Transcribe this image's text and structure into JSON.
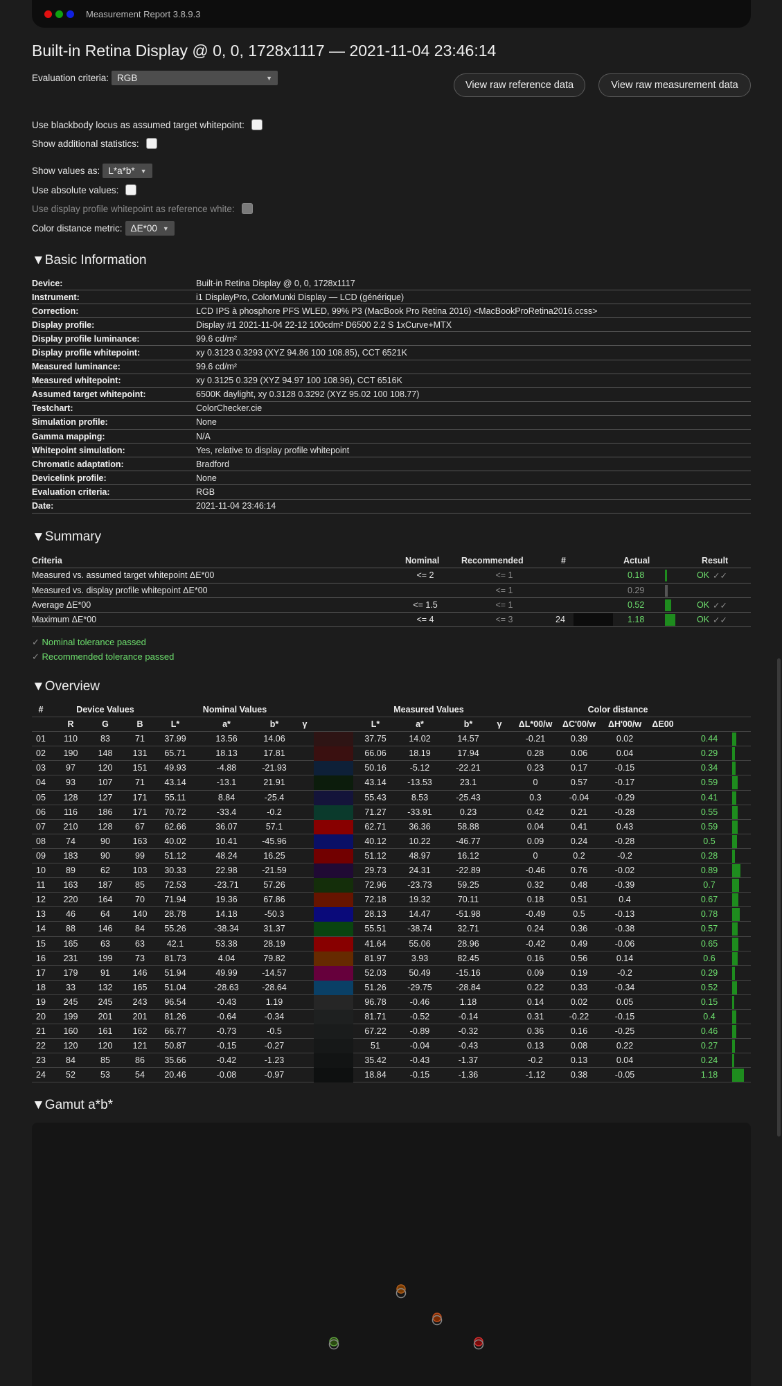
{
  "window": {
    "title": "Measurement Report 3.8.9.3"
  },
  "page_title": "Built-in Retina Display @ 0, 0, 1728x1117 — 2021-11-04 23:46:14",
  "controls": {
    "evaluation_label": "Evaluation criteria:",
    "evaluation_value": "RGB",
    "view_ref_button": "View raw reference data",
    "view_meas_button": "View raw measurement data",
    "blackbody_label": "Use blackbody locus as assumed target whitepoint:",
    "additional_stats_label": "Show additional statistics:",
    "show_values_label": "Show values as:",
    "show_values_value": "L*a*b*",
    "absolute_label": "Use absolute values:",
    "profile_white_label": "Use display profile whitepoint as reference white:",
    "distance_label": "Color distance metric:",
    "distance_value": "ΔE*00",
    "dropdown_arrow": "▼"
  },
  "sections": {
    "basic": "▼Basic Information",
    "summary": "▼Summary",
    "overview": "▼Overview",
    "gamut": "▼Gamut a*b*"
  },
  "basic_info": [
    {
      "k": "Device:",
      "v": "Built-in Retina Display @ 0, 0, 1728x1117"
    },
    {
      "k": "Instrument:",
      "v": "i1 DisplayPro, ColorMunki Display — LCD (générique)"
    },
    {
      "k": "Correction:",
      "v": "LCD IPS à phosphore PFS WLED, 99% P3 (MacBook Pro Retina 2016) <MacBookProRetina2016.ccss>"
    },
    {
      "k": "Display profile:",
      "v": "Display #1 2021-11-04 22-12 100cdm² D6500 2.2 S 1xCurve+MTX"
    },
    {
      "k": "Display profile luminance:",
      "v": "99.6 cd/m²"
    },
    {
      "k": "Display profile whitepoint:",
      "v": "xy 0.3123 0.3293 (XYZ 94.86 100 108.85), CCT 6521K"
    },
    {
      "k": "Measured luminance:",
      "v": "99.6 cd/m²"
    },
    {
      "k": "Measured whitepoint:",
      "v": "xy 0.3125 0.329 (XYZ 94.97 100 108.96), CCT 6516K"
    },
    {
      "k": "Assumed target whitepoint:",
      "v": "6500K daylight, xy 0.3128 0.3292 (XYZ 95.02 100 108.77)"
    },
    {
      "k": "Testchart:",
      "v": "ColorChecker.cie"
    },
    {
      "k": "Simulation profile:",
      "v": "None"
    },
    {
      "k": "Gamma mapping:",
      "v": "N/A"
    },
    {
      "k": "Whitepoint simulation:",
      "v": "Yes, relative to display profile whitepoint"
    },
    {
      "k": "Chromatic adaptation:",
      "v": "Bradford"
    },
    {
      "k": "Devicelink profile:",
      "v": "None"
    },
    {
      "k": "Evaluation criteria:",
      "v": "RGB"
    },
    {
      "k": "Date:",
      "v": "2021-11-04 23:46:14"
    }
  ],
  "summary": {
    "headers": {
      "criteria": "Criteria",
      "nominal": "Nominal",
      "recommended": "Recommended",
      "count": "#",
      "actual": "Actual",
      "result": "Result"
    },
    "rows": [
      {
        "criteria": "Measured vs. assumed target whitepoint ΔE*00",
        "nominal": "<= 2",
        "recommended": "<= 1",
        "count": "",
        "actual": "0.18",
        "fill": 0.09,
        "result": "OK",
        "ticks": "✓✓",
        "pass": true
      },
      {
        "criteria": "Measured vs. display profile whitepoint ΔE*00",
        "nominal": "",
        "recommended": "<= 1",
        "count": "",
        "actual": "0.29",
        "fill": 0.15,
        "result": "",
        "ticks": "",
        "pass": false
      },
      {
        "criteria": "Average ΔE*00",
        "nominal": "<= 1.5",
        "recommended": "<= 1",
        "count": "",
        "actual": "0.52",
        "fill": 0.35,
        "result": "OK",
        "ticks": "✓✓",
        "pass": true
      },
      {
        "criteria": "Maximum ΔE*00",
        "nominal": "<= 4",
        "recommended": "<= 3",
        "count": "24",
        "actual": "1.18",
        "fill": 0.6,
        "result": "OK",
        "ticks": "✓✓",
        "pass": true
      }
    ],
    "legend": [
      {
        "mark": "✓",
        "text": "Nominal tolerance passed"
      },
      {
        "mark": "✓",
        "text": "Recommended tolerance passed"
      }
    ]
  },
  "overview": {
    "group_headers": {
      "num": "#",
      "device": "Device Values",
      "nominal": "Nominal Values",
      "measured": "Measured Values",
      "distance": "Color distance"
    },
    "col_headers": {
      "r": "R",
      "g": "G",
      "b": "B",
      "L": "L*",
      "a": "a*",
      "bb": "b*",
      "gamma": "γ",
      "mL": "L*",
      "ma": "a*",
      "mb": "b*",
      "mgamma": "γ",
      "dL": "ΔL*00/w",
      "dC": "ΔC'00/w",
      "dH": "ΔH'00/w",
      "dE": "ΔE00"
    },
    "rows": [
      [
        "01",
        "110",
        "83",
        "71",
        "37.99",
        "13.56",
        "14.06",
        "#2e1414",
        "37.75",
        "14.02",
        "14.57",
        "-0.21",
        "0.39",
        "0.02",
        "0.44"
      ],
      [
        "02",
        "190",
        "148",
        "131",
        "65.71",
        "18.13",
        "17.81",
        "#3a1010",
        "66.06",
        "18.19",
        "17.94",
        "0.28",
        "0.06",
        "0.04",
        "0.29"
      ],
      [
        "03",
        "97",
        "120",
        "151",
        "49.93",
        "-4.88",
        "-21.93",
        "#0e2038",
        "50.16",
        "-5.12",
        "-22.21",
        "0.23",
        "0.17",
        "-0.15",
        "0.34"
      ],
      [
        "04",
        "93",
        "107",
        "71",
        "43.14",
        "-13.1",
        "21.91",
        "#0c1c0c",
        "43.14",
        "-13.53",
        "23.1",
        "0",
        "0.57",
        "-0.17",
        "0.59"
      ],
      [
        "05",
        "128",
        "127",
        "171",
        "55.11",
        "8.84",
        "-25.4",
        "#14143a",
        "55.43",
        "8.53",
        "-25.43",
        "0.3",
        "-0.04",
        "-0.29",
        "0.41"
      ],
      [
        "06",
        "116",
        "186",
        "171",
        "70.72",
        "-33.4",
        "-0.2",
        "#0a3a2c",
        "71.27",
        "-33.91",
        "0.23",
        "0.42",
        "0.21",
        "-0.28",
        "0.55"
      ],
      [
        "07",
        "210",
        "128",
        "67",
        "62.66",
        "36.07",
        "57.1",
        "#880000",
        "62.71",
        "36.36",
        "58.88",
        "0.04",
        "0.41",
        "0.43",
        "0.59"
      ],
      [
        "08",
        "74",
        "90",
        "163",
        "40.02",
        "10.41",
        "-45.96",
        "#0a1066",
        "40.12",
        "10.22",
        "-46.77",
        "0.09",
        "0.24",
        "-0.28",
        "0.5"
      ],
      [
        "09",
        "183",
        "90",
        "99",
        "51.12",
        "48.24",
        "16.25",
        "#720000",
        "51.12",
        "48.97",
        "16.12",
        "0",
        "0.2",
        "-0.2",
        "0.28"
      ],
      [
        "10",
        "89",
        "62",
        "103",
        "30.33",
        "22.98",
        "-21.59",
        "#200a34",
        "29.73",
        "24.31",
        "-22.89",
        "-0.46",
        "0.76",
        "-0.02",
        "0.89"
      ],
      [
        "11",
        "163",
        "187",
        "85",
        "72.53",
        "-23.71",
        "57.26",
        "#142e0a",
        "72.96",
        "-23.73",
        "59.25",
        "0.32",
        "0.48",
        "-0.39",
        "0.7"
      ],
      [
        "12",
        "220",
        "164",
        "70",
        "71.94",
        "19.36",
        "67.86",
        "#661400",
        "72.18",
        "19.32",
        "70.11",
        "0.18",
        "0.51",
        "0.4",
        "0.67"
      ],
      [
        "13",
        "46",
        "64",
        "140",
        "28.78",
        "14.18",
        "-50.3",
        "#0a0a7a",
        "28.13",
        "14.47",
        "-51.98",
        "-0.49",
        "0.5",
        "-0.13",
        "0.78"
      ],
      [
        "14",
        "88",
        "146",
        "84",
        "55.26",
        "-38.34",
        "31.37",
        "#0a4410",
        "55.51",
        "-38.74",
        "32.71",
        "0.24",
        "0.36",
        "-0.38",
        "0.57"
      ],
      [
        "15",
        "165",
        "63",
        "63",
        "42.1",
        "53.38",
        "28.19",
        "#880000",
        "41.64",
        "55.06",
        "28.96",
        "-0.42",
        "0.49",
        "-0.06",
        "0.65"
      ],
      [
        "16",
        "231",
        "199",
        "73",
        "81.73",
        "4.04",
        "79.82",
        "#662a00",
        "81.97",
        "3.93",
        "82.45",
        "0.16",
        "0.56",
        "0.14",
        "0.6"
      ],
      [
        "17",
        "179",
        "91",
        "146",
        "51.94",
        "49.99",
        "-14.57",
        "#66003c",
        "52.03",
        "50.49",
        "-15.16",
        "0.09",
        "0.19",
        "-0.2",
        "0.29"
      ],
      [
        "18",
        "33",
        "132",
        "165",
        "51.04",
        "-28.63",
        "-28.64",
        "#0a4066",
        "51.26",
        "-29.75",
        "-28.84",
        "0.22",
        "0.33",
        "-0.34",
        "0.52"
      ],
      [
        "19",
        "245",
        "245",
        "243",
        "96.54",
        "-0.43",
        "1.19",
        "#262626",
        "96.78",
        "-0.46",
        "1.18",
        "0.14",
        "0.02",
        "0.05",
        "0.15"
      ],
      [
        "20",
        "199",
        "201",
        "201",
        "81.26",
        "-0.64",
        "-0.34",
        "#1e2020",
        "81.71",
        "-0.52",
        "-0.14",
        "0.31",
        "-0.22",
        "-0.15",
        "0.4"
      ],
      [
        "21",
        "160",
        "161",
        "162",
        "66.77",
        "-0.73",
        "-0.5",
        "#1a1c1c",
        "67.22",
        "-0.89",
        "-0.32",
        "0.36",
        "0.16",
        "-0.25",
        "0.46"
      ],
      [
        "22",
        "120",
        "120",
        "121",
        "50.87",
        "-0.15",
        "-0.27",
        "#161818",
        "51",
        "-0.04",
        "-0.43",
        "0.13",
        "0.08",
        "0.22",
        "0.27"
      ],
      [
        "23",
        "84",
        "85",
        "86",
        "35.66",
        "-0.42",
        "-1.23",
        "#121414",
        "35.42",
        "-0.43",
        "-1.37",
        "-0.2",
        "0.13",
        "0.04",
        "0.24"
      ],
      [
        "24",
        "52",
        "53",
        "54",
        "20.46",
        "-0.08",
        "-0.97",
        "#0e1010",
        "18.84",
        "-0.15",
        "-1.36",
        "-1.12",
        "0.38",
        "-0.05",
        "1.18"
      ]
    ]
  },
  "colors": {
    "accent_green": "#6ee06e",
    "bar_green": "#1e8c1e",
    "background": "#1c1c1c"
  }
}
